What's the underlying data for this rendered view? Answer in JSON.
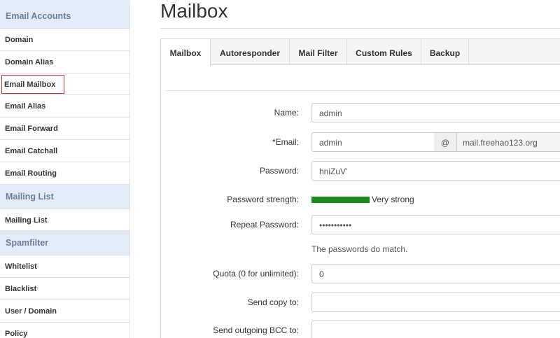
{
  "sidebar": {
    "sections": [
      {
        "title": "Email Accounts",
        "items": [
          "Domain",
          "Domain Alias",
          "Email Mailbox",
          "Email Alias",
          "Email Forward",
          "Email Catchall",
          "Email Routing"
        ]
      },
      {
        "title": "Mailing List",
        "items": [
          "Mailing List"
        ]
      },
      {
        "title": "Spamfilter",
        "items": [
          "Whitelist",
          "Blacklist",
          "User / Domain",
          "Policy"
        ]
      }
    ],
    "active_item": "Email Mailbox"
  },
  "page": {
    "title": "Mailbox"
  },
  "tabs": [
    "Mailbox",
    "Autoresponder",
    "Mail Filter",
    "Custom Rules",
    "Backup"
  ],
  "active_tab": "Mailbox",
  "form": {
    "name_label": "Name:",
    "name_value": "admin",
    "email_label": "Email:",
    "email_required_marker": "*",
    "email_local_value": "admin",
    "email_at": "@",
    "email_domain_value": "mail.freehao123.org",
    "password_label": "Password:",
    "password_value": "hniZuV'",
    "strength_label": "Password strength:",
    "strength_value": "Very strong",
    "strength_level": 1.0,
    "strength_color": "#1a8a1a",
    "repeat_label": "Repeat Password:",
    "repeat_value": "•••••••••••",
    "match_text": "The passwords do match.",
    "quota_label": "Quota (0 for unlimited):",
    "quota_value": "0",
    "copy_label": "Send copy to:",
    "copy_value": "",
    "bcc_label": "Send outgoing BCC to:",
    "bcc_value": ""
  },
  "colors": {
    "sidebar_section_bg": "#e3ecf6",
    "active_outline": "#cc3333",
    "strength": "#1a8a1a"
  }
}
